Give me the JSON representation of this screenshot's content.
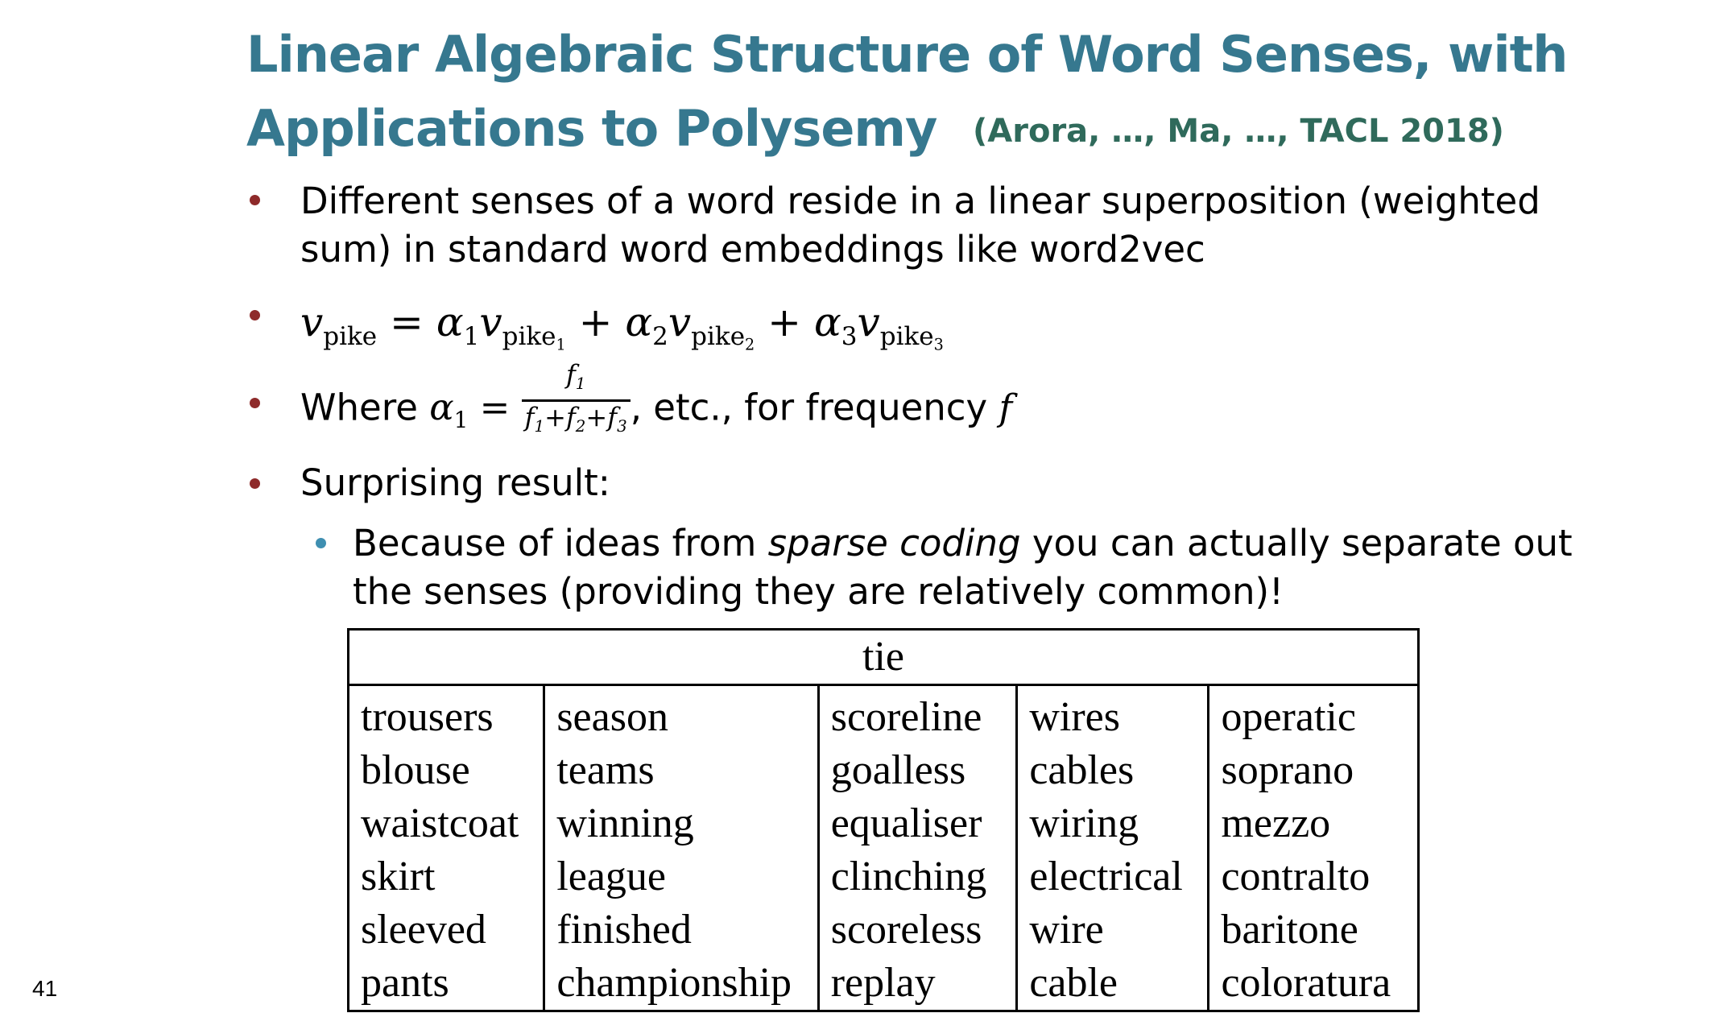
{
  "title": {
    "line1": "Linear Algebraic Structure of Word Senses, with",
    "line2": "Applications to Polysemy",
    "citation": "(Arora, …, Ma, …, TACL 2018)"
  },
  "bullets": {
    "b1_line1": "Different senses of a word reside in a linear superposition (weighted",
    "b1_line2": "sum) in standard word embeddings like word2vec",
    "b3_prefix": "Where ",
    "b3_suffix": ", etc., for frequency ",
    "b3_var": "f",
    "b4": "Surprising result:",
    "sub1_a": "Because of ideas from ",
    "sub1_em": "sparse coding",
    "sub1_b": " you can actually separate out",
    "sub1_line2": "the senses (providing they are relatively common)!"
  },
  "table": {
    "header": "tie",
    "columns": [
      [
        "trousers",
        "blouse",
        "waistcoat",
        "skirt",
        "sleeved",
        "pants"
      ],
      [
        "season",
        "teams",
        "winning",
        "league",
        "finished",
        "championship"
      ],
      [
        "scoreline",
        "goalless",
        "equaliser",
        "clinching",
        "scoreless",
        "replay"
      ],
      [
        "wires",
        "cables",
        "wiring",
        "electrical",
        "wire",
        "cable"
      ],
      [
        "operatic",
        "soprano",
        "mezzo",
        "contralto",
        "baritone",
        "coloratura"
      ]
    ]
  },
  "page_number": "41",
  "colors": {
    "title": "#36788f",
    "citation": "#2f6a5b",
    "bullet_l1": "#8e2a2a",
    "bullet_l2": "#3f8fb1"
  }
}
